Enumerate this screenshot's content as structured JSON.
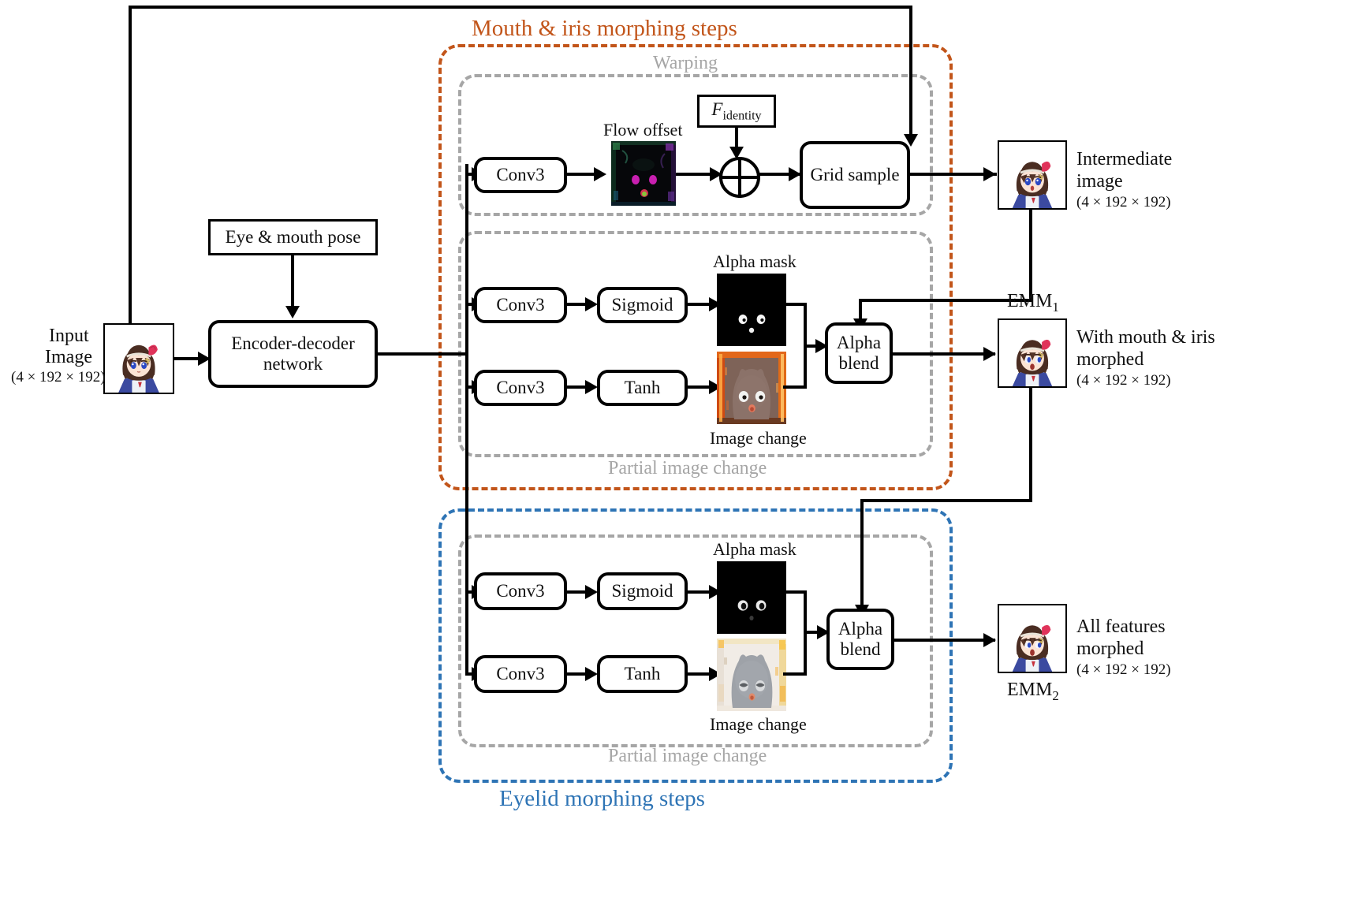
{
  "diagram": {
    "title": "Two-stage anime face morphing pipeline",
    "colors": {
      "orange": "#C2551A",
      "blue": "#2E74B5",
      "gray": "#A6A6A6",
      "black": "#000000"
    }
  },
  "groups": {
    "mouth_iris": {
      "label": "Mouth & iris morphing steps"
    },
    "eyelid": {
      "label": "Eyelid morphing steps"
    },
    "warping": {
      "label": "Warping"
    },
    "partial_change_top": {
      "label": "Partial image change"
    },
    "partial_change_bottom": {
      "label": "Partial image change"
    }
  },
  "nodes": {
    "eye_mouth_pose": {
      "label": "Eye & mouth pose"
    },
    "encoder_decoder": {
      "label": "Encoder-decoder network"
    },
    "f_identity": {
      "label_italic": "F",
      "label_sub": "identity"
    },
    "conv3_warp": {
      "label": "Conv3"
    },
    "grid_sample": {
      "label": "Grid sample"
    },
    "conv3_mask_top": {
      "label": "Conv3"
    },
    "sigmoid_top": {
      "label": "Sigmoid"
    },
    "conv3_change_top": {
      "label": "Conv3"
    },
    "tanh_top": {
      "label": "Tanh"
    },
    "alpha_blend_top": {
      "label": "Alpha blend"
    },
    "conv3_mask_bottom": {
      "label": "Conv3"
    },
    "sigmoid_bottom": {
      "label": "Sigmoid"
    },
    "conv3_change_bottom": {
      "label": "Conv3"
    },
    "tanh_bottom": {
      "label": "Tanh"
    },
    "alpha_blend_bottom": {
      "label": "Alpha blend"
    }
  },
  "images": {
    "input": {
      "caption_line1": "Input",
      "caption_line2": "Image",
      "dims": "(4 × 192 × 192)"
    },
    "flow_offset": {
      "caption": "Flow offset"
    },
    "intermediate": {
      "caption_line1": "Intermediate",
      "caption_line2": "image",
      "dims": "(4 × 192 × 192)"
    },
    "alpha_mask_top": {
      "caption": "Alpha mask"
    },
    "image_change_top": {
      "caption": "Image change"
    },
    "emm1": {
      "tag": "EMM",
      "tag_sub": "1",
      "caption_line1": "With mouth & iris",
      "caption_line2": "morphed",
      "dims": "(4 × 192 × 192)"
    },
    "alpha_mask_bottom": {
      "caption": "Alpha mask"
    },
    "image_change_bottom": {
      "caption": "Image change"
    },
    "emm2": {
      "tag": "EMM",
      "tag_sub": "2",
      "caption_line1": "All features",
      "caption_line2": "morphed",
      "dims": "(4 × 192 × 192)"
    }
  }
}
